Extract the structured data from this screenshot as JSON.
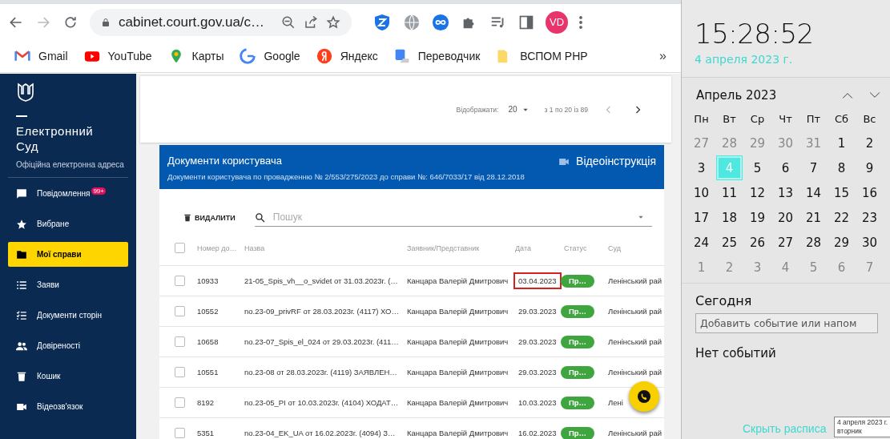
{
  "browser": {
    "address": "cabinet.court.gov.ua/c…",
    "avatar": "VD",
    "bookmarks": [
      {
        "label": "Gmail"
      },
      {
        "label": "YouTube"
      },
      {
        "label": "Карты"
      },
      {
        "label": "Google"
      },
      {
        "label": "Яндекс"
      },
      {
        "label": "Переводчик"
      },
      {
        "label": "ВСПОМ PHP"
      }
    ],
    "more": "»"
  },
  "sidebar": {
    "title": "Електронний Суд",
    "subtitle": "Офіційна електронна адреса",
    "items": [
      {
        "label": "Повідомлення",
        "badge": "99+",
        "selected": false
      },
      {
        "label": "Вибране",
        "selected": false
      },
      {
        "label": "Мої справи",
        "selected": true
      },
      {
        "label": "Заяви",
        "selected": false
      },
      {
        "label": "Документи сторін",
        "selected": false
      },
      {
        "label": "Довіреності",
        "selected": false
      },
      {
        "label": "Кошик",
        "selected": false
      },
      {
        "label": "Відеозв'язок",
        "selected": false
      }
    ]
  },
  "pagination": {
    "label": "Відображати:",
    "page_size": "20",
    "range": "з 1 по 20 із 89"
  },
  "documents": {
    "title": "Документи користувача",
    "subtitle": "Документи користувача по провадженню № 2/553/275/2023 до справи №: 646/7033/17 від 28.12.2018",
    "video_link": "Відеоінструкція",
    "delete_button": "ВИДАЛИТИ",
    "search": {
      "placeholder": "Пошук"
    },
    "header_checked": false,
    "columns": [
      "Номер до…",
      "Назва",
      "Заявник/Представник",
      "Дата",
      "Статус",
      "Суд"
    ],
    "rows": [
      {
        "checked": false,
        "number": "10933",
        "name": "21-05_Spis_vh__o_svidet от 31.03.2023г. (…",
        "applicant": "Канцара Валерій Дмитрович",
        "date": "03.04.2023",
        "highlighted": true,
        "status": "Пр…",
        "court": "Ленінський рай"
      },
      {
        "checked": false,
        "number": "10552",
        "name": "no.23-09_privRF от 28.03.2023г. (4117) ХО…",
        "applicant": "Канцара Валерій Дмитрович",
        "date": "29.03.2023",
        "highlighted": false,
        "status": "Пр…",
        "court": "Ленінський рай"
      },
      {
        "checked": false,
        "number": "10658",
        "name": "no.23-07_Spis_el_024 от 29.03.2023г. (411…",
        "applicant": "Канцара Валерій Дмитрович",
        "date": "29.03.2023",
        "highlighted": false,
        "status": "Пр…",
        "court": "Ленінський рай"
      },
      {
        "checked": false,
        "number": "10551",
        "name": "no.23-08 от 28.03.2023г. (4119) ЗАЯВЛЕН…",
        "applicant": "Канцара Валерій Дмитрович",
        "date": "29.03.2023",
        "highlighted": false,
        "status": "Пр…",
        "court": "Ленінський рай"
      },
      {
        "checked": false,
        "number": "8192",
        "name": "no.23-05_PI от 10.03.2023г. (4104) ХОДАТ…",
        "applicant": "Канцара Валерій Дмитрович",
        "date": "10.03.2023",
        "highlighted": false,
        "status": "Пр…",
        "court": "Лені"
      },
      {
        "checked": false,
        "number": "5351",
        "name": "no.23-04_EK_UA от 16.02.2023г. (4094) З…",
        "applicant": "Канцара Валерій Дмитрович",
        "date": "16.02.2023",
        "highlighted": false,
        "status": "Пр…",
        "court": "Ленінський рай"
      }
    ]
  },
  "calendar": {
    "time": "15:28:52",
    "date": "4 апреля 2023 г.",
    "month": "Апрель 2023",
    "weekdays": [
      "Пн",
      "Вт",
      "Ср",
      "Чт",
      "Пт",
      "Сб",
      "Вс"
    ],
    "days": [
      {
        "day": "27",
        "other_month": true,
        "selected": false
      },
      {
        "day": "28",
        "other_month": true,
        "selected": false
      },
      {
        "day": "29",
        "other_month": true,
        "selected": false
      },
      {
        "day": "30",
        "other_month": true,
        "selected": false
      },
      {
        "day": "31",
        "other_month": true,
        "selected": false
      },
      {
        "day": "1",
        "other_month": false,
        "selected": false
      },
      {
        "day": "2",
        "other_month": false,
        "selected": false
      },
      {
        "day": "3",
        "other_month": false,
        "selected": false
      },
      {
        "day": "4",
        "other_month": false,
        "selected": true
      },
      {
        "day": "5",
        "other_month": false,
        "selected": false
      },
      {
        "day": "6",
        "other_month": false,
        "selected": false
      },
      {
        "day": "7",
        "other_month": false,
        "selected": false
      },
      {
        "day": "8",
        "other_month": false,
        "selected": false
      },
      {
        "day": "9",
        "other_month": false,
        "selected": false
      },
      {
        "day": "10",
        "other_month": false,
        "selected": false
      },
      {
        "day": "11",
        "other_month": false,
        "selected": false
      },
      {
        "day": "12",
        "other_month": false,
        "selected": false
      },
      {
        "day": "13",
        "other_month": false,
        "selected": false
      },
      {
        "day": "14",
        "other_month": false,
        "selected": false
      },
      {
        "day": "15",
        "other_month": false,
        "selected": false
      },
      {
        "day": "16",
        "other_month": false,
        "selected": false
      },
      {
        "day": "17",
        "other_month": false,
        "selected": false
      },
      {
        "day": "18",
        "other_month": false,
        "selected": false
      },
      {
        "day": "19",
        "other_month": false,
        "selected": false
      },
      {
        "day": "20",
        "other_month": false,
        "selected": false
      },
      {
        "day": "21",
        "other_month": false,
        "selected": false
      },
      {
        "day": "22",
        "other_month": false,
        "selected": false
      },
      {
        "day": "23",
        "other_month": false,
        "selected": false
      },
      {
        "day": "24",
        "other_month": false,
        "selected": false
      },
      {
        "day": "25",
        "other_month": false,
        "selected": false
      },
      {
        "day": "26",
        "other_month": false,
        "selected": false
      },
      {
        "day": "27",
        "other_month": false,
        "selected": false
      },
      {
        "day": "28",
        "other_month": false,
        "selected": false
      },
      {
        "day": "29",
        "other_month": false,
        "selected": false
      },
      {
        "day": "30",
        "other_month": false,
        "selected": false
      },
      {
        "day": "1",
        "other_month": true,
        "selected": false
      },
      {
        "day": "2",
        "other_month": true,
        "selected": false
      },
      {
        "day": "3",
        "other_month": true,
        "selected": false
      },
      {
        "day": "4",
        "other_month": true,
        "selected": false
      },
      {
        "day": "5",
        "other_month": true,
        "selected": false
      },
      {
        "day": "6",
        "other_month": true,
        "selected": false
      },
      {
        "day": "7",
        "other_month": true,
        "selected": false
      }
    ],
    "today_heading": "Сегодня",
    "event_input": {
      "placeholder": "Добавить событие или напом"
    },
    "no_events": "Нет событий",
    "hide_link": "Скрыть расписа",
    "tooltip": {
      "date": "4 апреля 2023 г.",
      "weekday": "вторник"
    }
  }
}
